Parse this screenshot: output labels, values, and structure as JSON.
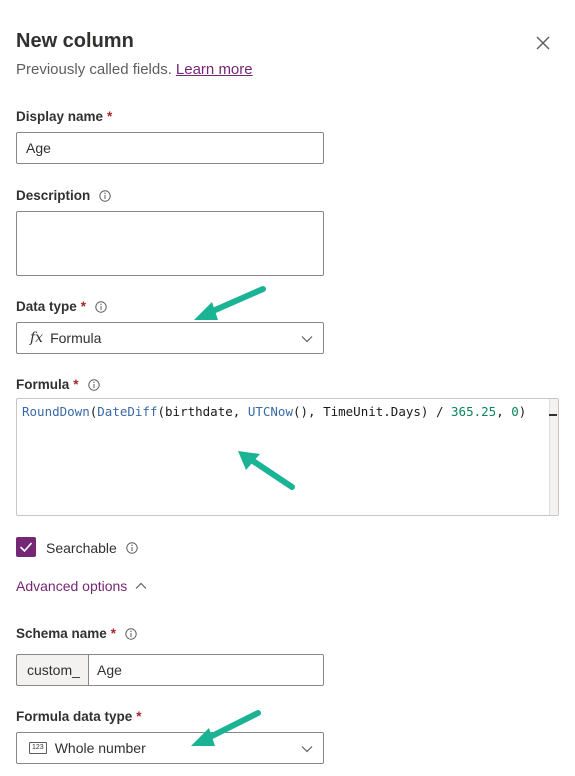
{
  "header": {
    "title": "New column",
    "subtitle": "Previously called fields.",
    "learn_more": "Learn more"
  },
  "fields": {
    "display_name": {
      "label": "Display name",
      "required": "*",
      "value": "Age"
    },
    "description": {
      "label": "Description",
      "value": ""
    },
    "data_type": {
      "label": "Data type",
      "required": "*",
      "icon": "fx",
      "value": "Formula"
    },
    "formula": {
      "label": "Formula",
      "required": "*",
      "tokens": {
        "fn1": "RoundDown",
        "p1": "(",
        "fn2": "DateDiff",
        "p2": "(",
        "arg1": "birthdate",
        "p3": ", ",
        "fn3": "UTCNow",
        "p4": "(), ",
        "arg2": "TimeUnit.Days",
        "p5": ") / ",
        "num1": "365.25",
        "p6": ", ",
        "num2": "0",
        "p7": ")"
      }
    },
    "searchable": {
      "label": "Searchable",
      "checked": true
    },
    "advanced": {
      "label": "Advanced options"
    },
    "schema_name": {
      "label": "Schema name",
      "required": "*",
      "prefix": "custom_",
      "value": "Age"
    },
    "formula_data_type": {
      "label": "Formula data type",
      "required": "*",
      "icon": "123",
      "value": "Whole number"
    }
  },
  "colors": {
    "accent": "#742774",
    "required": "#a4262c",
    "arrow": "#1ab394"
  }
}
